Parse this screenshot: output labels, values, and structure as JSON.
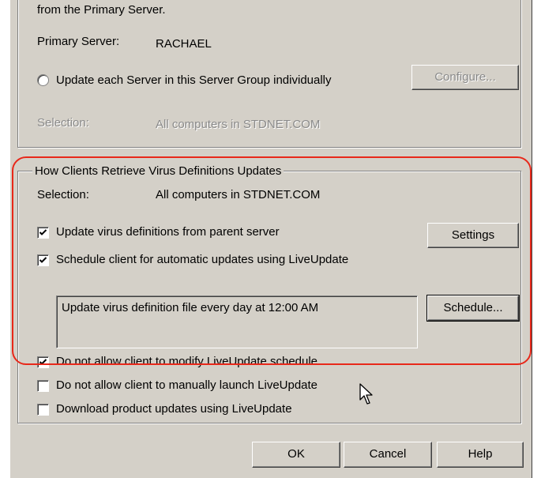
{
  "server_section": {
    "intro_text": "from the Primary Server.",
    "primary_server_label": "Primary Server:",
    "primary_server_value": "RACHAEL",
    "radio_label": "Update each Server in this Server Group individually",
    "configure_button": "Configure...",
    "selection_label": "Selection:",
    "selection_value": "All computers in STDNET.COM"
  },
  "client_group": {
    "legend": "How Clients Retrieve Virus Definitions Updates",
    "selection_label": "Selection:",
    "selection_value": "All computers in STDNET.COM",
    "update_from_parent": {
      "label": "Update virus definitions from parent server",
      "checked": true
    },
    "settings_button": "Settings",
    "schedule_client": {
      "label": "Schedule client for automatic updates using LiveUpdate",
      "checked": true
    },
    "schedule_text": "Update virus definition file every day at 12:00 AM",
    "schedule_button": "Schedule...",
    "no_modify_schedule": {
      "label": "Do not allow client to modify LiveUpdate schedule",
      "checked": true
    }
  },
  "extra_options": {
    "no_manual_launch": {
      "label": "Do not allow client to manually launch LiveUpdate",
      "checked": false
    },
    "download_product_updates": {
      "label": "Download product updates using LiveUpdate",
      "checked": false
    }
  },
  "footer_buttons": {
    "ok": "OK",
    "cancel": "Cancel",
    "help": "Help"
  },
  "colors": {
    "highlight": "#e8281a",
    "dialog_bg": "#d4d0c8"
  }
}
